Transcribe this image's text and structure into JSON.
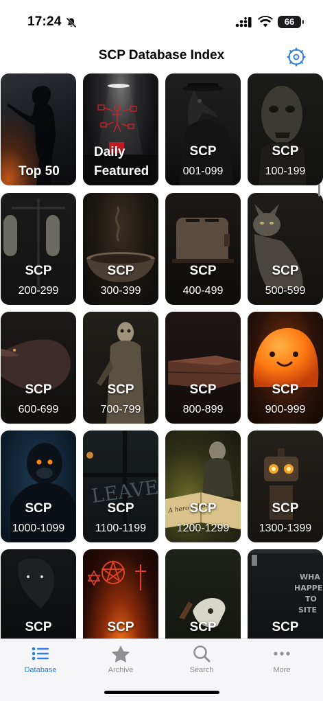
{
  "status_bar": {
    "time": "17:24",
    "battery": "66"
  },
  "nav": {
    "title": "SCP Database Index"
  },
  "tiles": [
    {
      "special": "Top 50",
      "theme": "woman"
    },
    {
      "special_lines": [
        "Daily",
        "Featured"
      ],
      "theme": "lab"
    },
    {
      "line1": "SCP",
      "line2": "001-099",
      "theme": "plague"
    },
    {
      "line1": "SCP",
      "line2": "100-199",
      "theme": "zombie"
    },
    {
      "line1": "SCP",
      "line2": "200-299",
      "theme": "scale"
    },
    {
      "line1": "SCP",
      "line2": "300-399",
      "theme": "bowl"
    },
    {
      "line1": "SCP",
      "line2": "400-499",
      "theme": "toaster"
    },
    {
      "line1": "SCP",
      "line2": "500-599",
      "theme": "cat"
    },
    {
      "line1": "SCP",
      "line2": "600-699",
      "theme": "lizard"
    },
    {
      "line1": "SCP",
      "line2": "700-799",
      "theme": "mummy"
    },
    {
      "line1": "SCP",
      "line2": "800-899",
      "theme": "coffin"
    },
    {
      "line1": "SCP",
      "line2": "900-999",
      "theme": "blob"
    },
    {
      "line1": "SCP",
      "line2": "1000-1099",
      "theme": "gorilla"
    },
    {
      "line1": "SCP",
      "line2": "1100-1199",
      "theme": "window",
      "art_text": "LEAVE!"
    },
    {
      "line1": "SCP",
      "line2": "1200-1299",
      "theme": "book",
      "art_text": "A hero is born."
    },
    {
      "line1": "SCP",
      "line2": "1300-1399",
      "theme": "robot"
    },
    {
      "line1": "SCP",
      "theme": "bird"
    },
    {
      "line1": "SCP",
      "theme": "pentagram"
    },
    {
      "line1": "SCP",
      "theme": "skull"
    },
    {
      "line1": "SCP",
      "theme": "wall",
      "art_text": [
        "WHA",
        "HAPPE",
        "TO",
        "SITE"
      ]
    }
  ],
  "tabs": [
    {
      "label": "Database",
      "icon": "list-icon",
      "active": true
    },
    {
      "label": "Archive",
      "icon": "star-icon",
      "active": false
    },
    {
      "label": "Search",
      "icon": "magnifier-icon",
      "active": false
    },
    {
      "label": "More",
      "icon": "ellipsis-icon",
      "active": false
    }
  ],
  "colors": {
    "accent": "#2f7fe0",
    "inactive": "#8e8e93",
    "tab_bar_bg": "#f6f6f8"
  }
}
